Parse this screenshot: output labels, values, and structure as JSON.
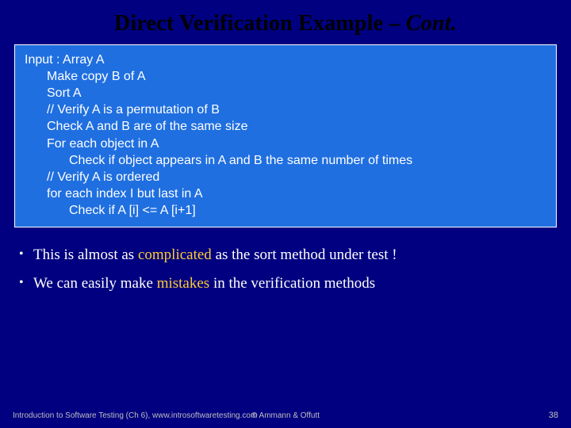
{
  "title_main": "Direct Verification Example – ",
  "title_cont": "Cont.",
  "code": {
    "l0": "Input : Array A",
    "l1": "Make copy B of A",
    "l2": "Sort A",
    "l3": "// Verify A is a permutation of B",
    "l4": "Check A and B are of the same size",
    "l5": "For each object in A",
    "l6": "Check if object appears in A and B the same number of times",
    "l7": "// Verify A is ordered",
    "l8": "for each index I but last in A",
    "l9": "Check if A [i] <= A [i+1]"
  },
  "bullets": {
    "b1_pre": "This is almost as ",
    "b1_emph": "complicated",
    "b1_post": " as the sort method under test !",
    "b2_pre": "We can easily make ",
    "b2_emph": "mistakes",
    "b2_post": " in the verification methods"
  },
  "footer": {
    "left": "Introduction to Software Testing (Ch 6), www.introsoftwaretesting.com",
    "center": "© Ammann & Offutt",
    "right": "38"
  }
}
